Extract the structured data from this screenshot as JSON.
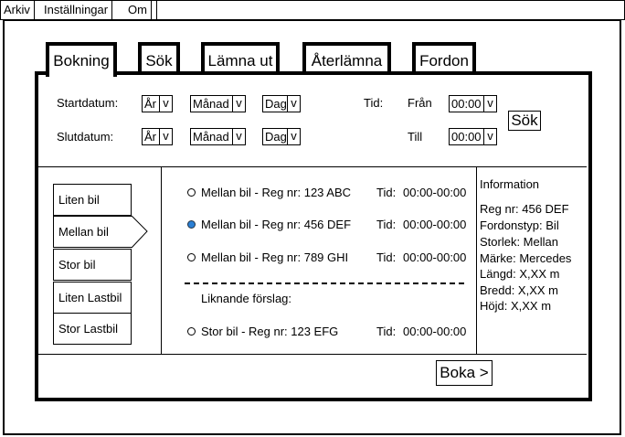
{
  "menu": [
    "Arkiv",
    "Inställningar",
    "Om"
  ],
  "tabs": [
    "Bokning",
    "Sök",
    "Lämna ut",
    "Återlämna",
    "Fordon"
  ],
  "search": {
    "start_label": "Startdatum:",
    "end_label": "Slutdatum:",
    "year": "År",
    "month": "Månad",
    "day": "Dag",
    "arrow": "v",
    "time_label": "Tid:",
    "from_label": "Från",
    "to_label": "Till",
    "from_value": "00:00",
    "to_value": "00:00",
    "search_button": "Sök"
  },
  "categories": [
    "Liten bil",
    "Mellan bil",
    "Stor bil",
    "Liten Lastbil",
    "Stor Lastbil"
  ],
  "selected_category": "Mellan bil",
  "results": [
    {
      "text": "Mellan bil - Reg nr: 123 ABC",
      "time_label": "Tid:",
      "time": "00:00-00:00",
      "selected": false
    },
    {
      "text": "Mellan bil - Reg nr: 456 DEF",
      "time_label": "Tid:",
      "time": "00:00-00:00",
      "selected": true
    },
    {
      "text": "Mellan bil - Reg nr: 789 GHI",
      "time_label": "Tid:",
      "time": "00:00-00:00",
      "selected": false
    }
  ],
  "suggestions_label": "Liknande förslag:",
  "suggestion": {
    "text": "Stor bil - Reg nr: 123 EFG",
    "time_label": "Tid:",
    "time": "00:00-00:00",
    "selected": false
  },
  "info": {
    "title": "Information",
    "lines": [
      "Reg nr: 456 DEF",
      "Fordonstyp: Bil",
      "Storlek: Mellan",
      "Märke: Mercedes",
      "Längd: X,XX m",
      "Bredd: X,XX m",
      "Höjd: X,XX m"
    ]
  },
  "book_button": "Boka >",
  "colors": {
    "selected_radio": "#2a7fd4"
  }
}
